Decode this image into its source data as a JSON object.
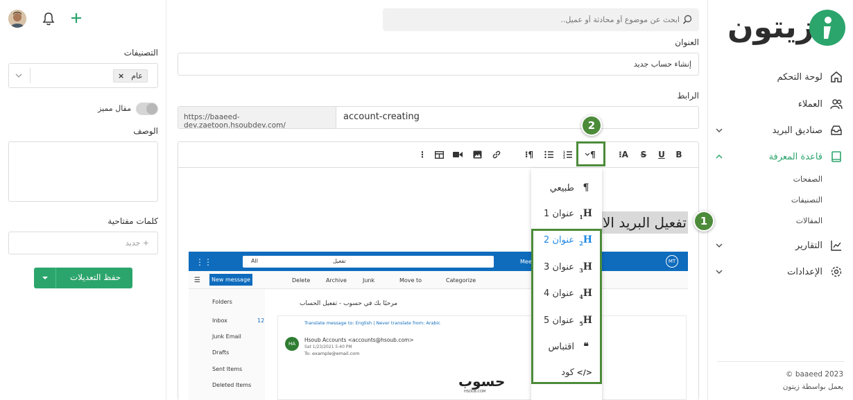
{
  "colors": {
    "brand": "#2ca56c",
    "callout": "#4c8b3a",
    "outlook": "#0f6cbd",
    "active_nav": "#2ca56c"
  },
  "topbar": {
    "search_placeholder": "ابحث عن موضوع أو محادثة أو عميل.."
  },
  "logo": {
    "text": "زيتون"
  },
  "sidebar": {
    "items": [
      {
        "label": "لوحة التحكم",
        "icon": "home-icon"
      },
      {
        "label": "العملاء",
        "icon": "users-icon"
      },
      {
        "label": "صناديق البريد",
        "icon": "inbox-icon"
      },
      {
        "label": "قاعدة المعرفة",
        "icon": "book-icon"
      },
      {
        "label": "التقارير",
        "icon": "chart-icon"
      },
      {
        "label": "الإعدادات",
        "icon": "gear-icon"
      }
    ],
    "subitems": [
      "الصفحات",
      "التصنيفات",
      "المقالات"
    ],
    "footer_copyright": "© baaeed 2023",
    "footer_powered": "يعمل بواسطة زيتون"
  },
  "form": {
    "title_label": "العنوان",
    "title_value": "إنشاء حساب جديد",
    "link_label": "الرابط",
    "link_prefix": "https://baaeed-dev.zaetoon.hsoubdev.com/",
    "link_value": "account-creating"
  },
  "editor": {
    "heading_text": "تفعيل البريد الا",
    "toolbar": [
      "B",
      "U",
      "S",
      "A",
      "¶"
    ]
  },
  "dropdown": {
    "items": [
      {
        "label": "طبيعي",
        "sym": "¶",
        "sub": ""
      },
      {
        "label": "عنوان 1",
        "sym": "H",
        "sub": "1"
      },
      {
        "label": "عنوان 2",
        "sym": "H",
        "sub": "2"
      },
      {
        "label": "عنوان 3",
        "sym": "H",
        "sub": "3"
      },
      {
        "label": "عنوان 4",
        "sym": "H",
        "sub": "4"
      },
      {
        "label": "عنوان 5",
        "sym": "H",
        "sub": "5"
      },
      {
        "label": "اقتباس",
        "sym": "❝",
        "sub": ""
      },
      {
        "label": "كود",
        "sym": "</>",
        "sub": ""
      }
    ]
  },
  "callouts": {
    "one": "1",
    "two": "2"
  },
  "side_panel": {
    "categories_label": "التصنيفات",
    "category_tag": "عام",
    "featured_label": "مقال مميز",
    "description_label": "الوصف",
    "keywords_label": "كلمات مفتاحية",
    "keywords_placeholder": "+ جديد",
    "save_label": "حفظ التعديلات"
  },
  "outlook": {
    "scope": "All",
    "search_text": "تفعيل",
    "meet": "Mee",
    "avatar": "MT",
    "new_message": "New message",
    "actions": [
      "Delete",
      "Archive",
      "Junk",
      "Move to",
      "Categorize"
    ],
    "folders_header": "Folders",
    "folders": [
      {
        "name": "Inbox",
        "count": "12"
      },
      {
        "name": "Junk Email",
        "count": ""
      },
      {
        "name": "Drafts",
        "count": ""
      },
      {
        "name": "Sent Items",
        "count": ""
      },
      {
        "name": "Deleted Items",
        "count": ""
      }
    ],
    "subject": "مرحبًا بك في حسوب - تفعيل الحساب",
    "translate": "Translate message to: English | Never translate from: Arabic",
    "sender_initials": "HA",
    "sender": "Hsoub Accounts <accounts@hsoub.com>",
    "date": "Sat 1/23/2021 5:40 PM",
    "to": "To: example@email.com",
    "logo_text": "حسوب",
    "logo_sub": "HSOUB.COM"
  }
}
